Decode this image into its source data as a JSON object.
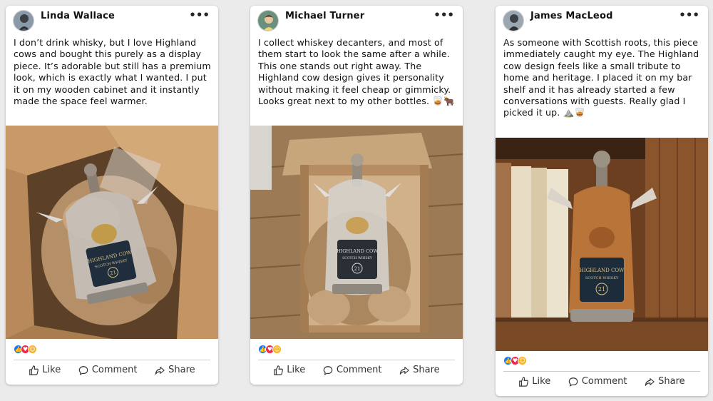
{
  "posts": [
    {
      "author": "Linda Wallace",
      "text": "I don’t drink whisky, but I love Highland cows and bought this purely as a display piece. It’s adorable but still has a premium look, which is exactly what I wanted. I put it on my wooden cabinet and it instantly made the space feel warmer.",
      "photo_icon": "highland-cow-decanter-in-box-photo",
      "actions": {
        "like": "Like",
        "comment": "Comment",
        "share": "Share"
      }
    },
    {
      "author": "Michael Turner",
      "text": "I collect whiskey decanters, and most of them start to look the same after a while. This one stands out right away. The Highland cow design gives it personality without making it feel cheap or gimmicky. Looks great next to my other bottles. 🥃🐂",
      "photo_icon": "highland-cow-decanter-in-box-photo",
      "actions": {
        "like": "Like",
        "comment": "Comment",
        "share": "Share"
      }
    },
    {
      "author": "James MacLeod",
      "text": "As someone with Scottish roots, this piece immediately caught my eye. The Highland cow design feels like a small tribute to home and heritage. I placed it on my bar shelf and it has already started a few conversations with guests. Really glad I picked it up. ⛰️🥃",
      "photo_icon": "highland-cow-decanter-on-shelf-photo",
      "actions": {
        "like": "Like",
        "comment": "Comment",
        "share": "Share"
      }
    }
  ],
  "label_text": {
    "brand": "HIGHLAND COW",
    "sub": "SCOTCH WHISKY",
    "age": "21"
  },
  "colors": {
    "like_blue": "#1877f2",
    "love_red": "#f02849",
    "care_yellow": "#f7b125"
  }
}
